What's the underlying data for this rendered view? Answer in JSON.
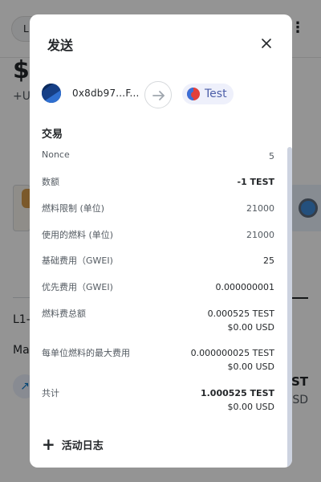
{
  "background": {
    "pill_text": "L",
    "balance": "$",
    "sub_text": "+U",
    "l1_text": "L1-",
    "ma_text": "Ma",
    "asset_symbol": "TEST",
    "asset_sub": "SD",
    "arrow_glyph": "↗"
  },
  "modal": {
    "title": "发送",
    "close_icon": "close-icon",
    "from_address": "0x8db97...F...",
    "to_label": "Test",
    "section_title": "交易",
    "rows": [
      {
        "label": "Nonce",
        "values": [
          "5"
        ]
      },
      {
        "label": "数额",
        "values": [
          "-1 TEST"
        ]
      },
      {
        "label": "燃料限制 (单位)",
        "values": [
          "21000"
        ]
      },
      {
        "label": "使用的燃料 (单位)",
        "values": [
          "21000"
        ]
      },
      {
        "label": "基础费用（GWEI)",
        "values": [
          "25"
        ]
      },
      {
        "label": "优先费用（GWEI)",
        "values": [
          "0.000000001"
        ]
      },
      {
        "label": "燃料费总额",
        "values": [
          "0.000525 TEST",
          "$0.00 USD"
        ]
      },
      {
        "label": "每单位燃料的最大费用",
        "values": [
          "0.000000025 TEST",
          "$0.00 USD"
        ]
      },
      {
        "label": "共计",
        "values": [
          "1.000525 TEST",
          "$0.00 USD"
        ]
      }
    ],
    "activity_plus": "+",
    "activity_label": "活动日志"
  },
  "colors": {
    "accent": "#4c5ea8",
    "pill_bg": "#eef0fb",
    "text_primary": "#24272a",
    "text_secondary": "#535a61"
  }
}
